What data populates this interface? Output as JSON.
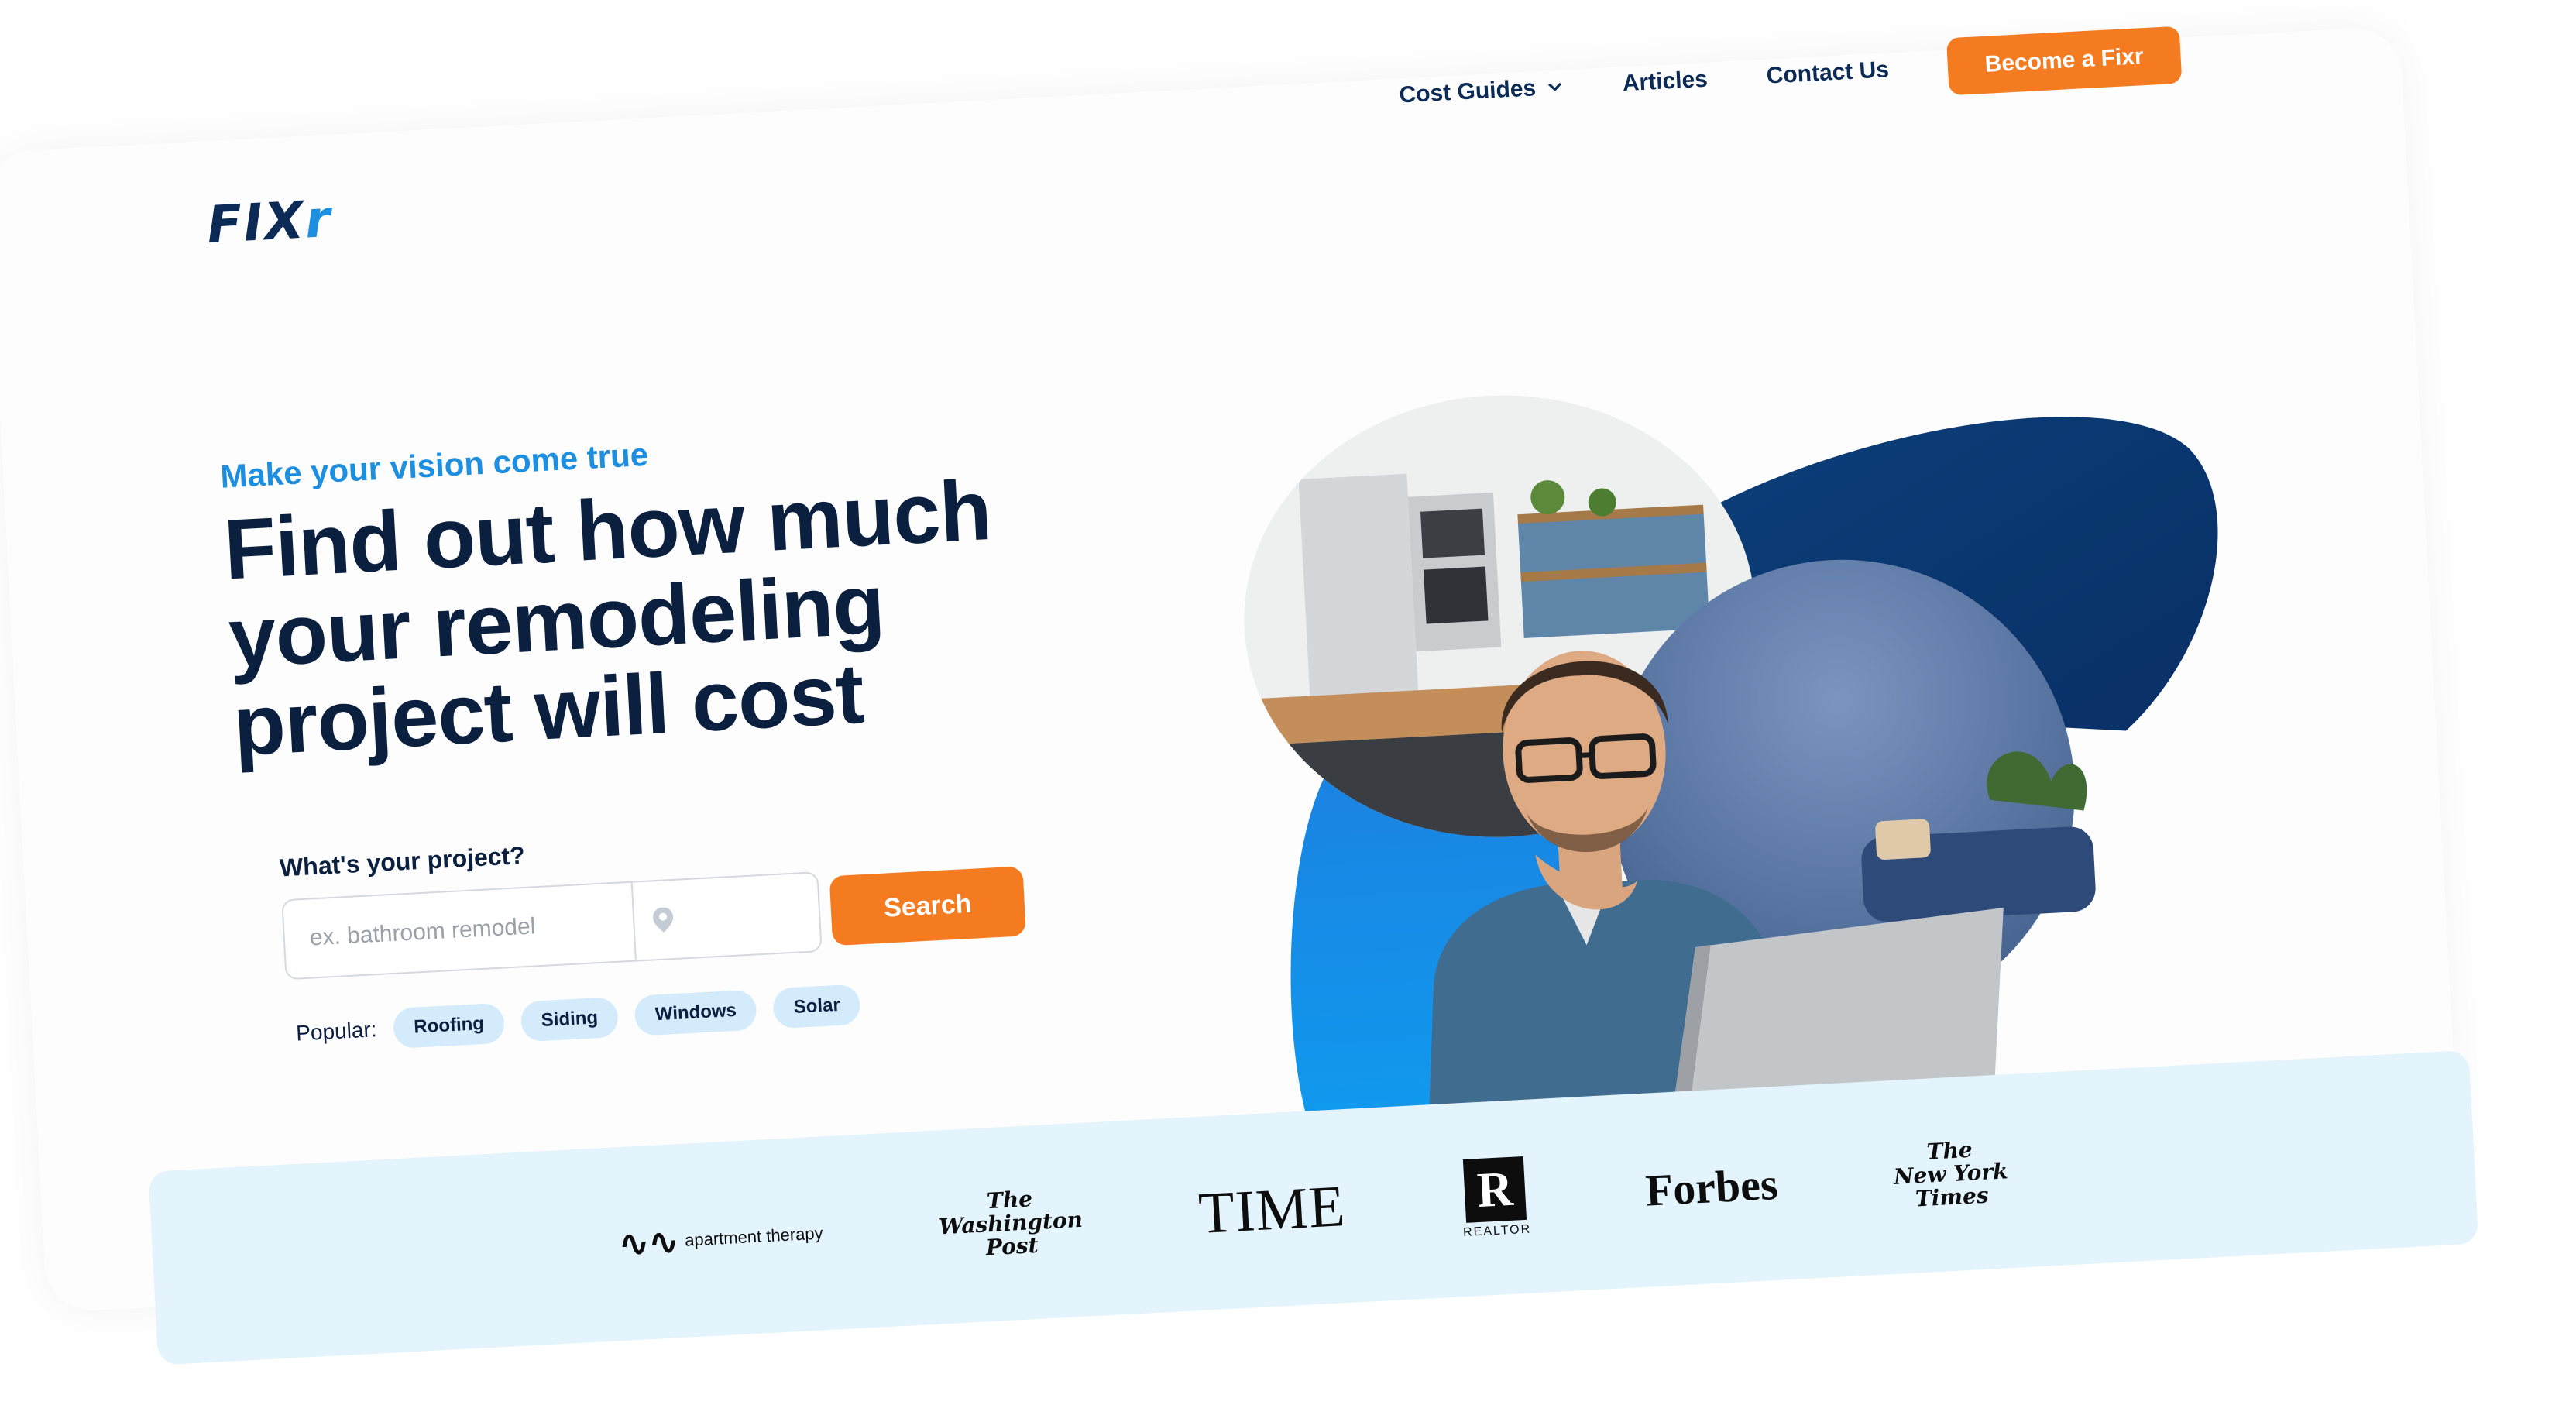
{
  "brand": {
    "logo_main": "FIX",
    "logo_accent": "r"
  },
  "nav": {
    "cost_guides": "Cost Guides",
    "articles": "Articles",
    "contact": "Contact Us",
    "cta": "Become a Fixr"
  },
  "hero": {
    "tagline": "Make your vision come true",
    "headline": "Find out how much your remodeling project will cost",
    "project_label": "What's your project?",
    "search_placeholder": "ex. bathroom remodel",
    "search_button": "Search",
    "popular_label": "Popular:",
    "chips": [
      "Roofing",
      "Siding",
      "Windows",
      "Solar"
    ]
  },
  "press": {
    "apartment_therapy": "apartment therapy",
    "washington_post": "The\nWashington\nPost",
    "time": "TIME",
    "realtor": "REALTOR",
    "forbes": "Forbes",
    "nyt": "The\nNew York\nTimes"
  },
  "colors": {
    "brand_navy": "#0b2a55",
    "accent_blue": "#1c8fe0",
    "cta_orange": "#f47b20",
    "chip_bg": "#d3ebfb",
    "press_bg": "#e3f4fd"
  },
  "icons": {
    "cost_guides": "chevron-down-icon",
    "location": "map-pin-icon"
  }
}
